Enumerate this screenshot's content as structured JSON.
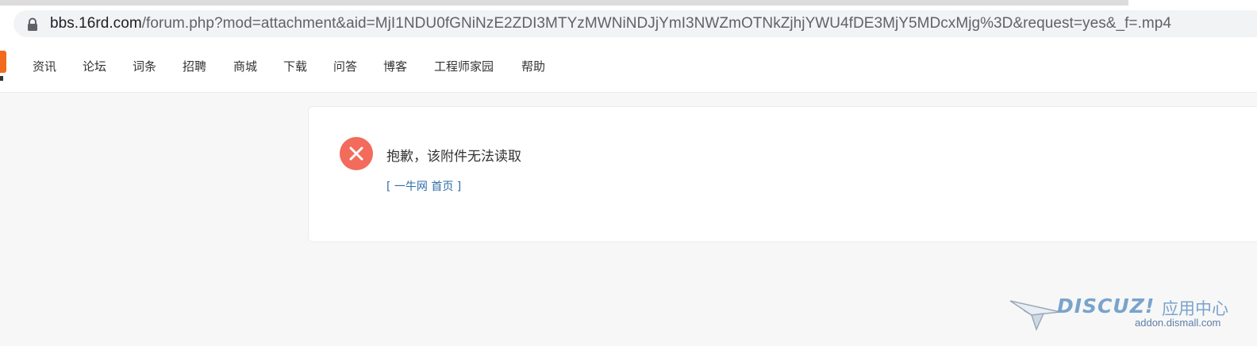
{
  "browser": {
    "url_host": "bbs.16rd.com",
    "url_rest": "/forum.php?mod=attachment&aid=MjI1NDU0fGNiNzE2ZDI3MTYzMWNiNDJjYmI3NWZmOTNkZjhjYWU4fDE3MjY5MDcxMjg%3D&request=yes&_f=.mp4"
  },
  "nav": {
    "items": [
      "资讯",
      "论坛",
      "词条",
      "招聘",
      "商城",
      "下载",
      "问答",
      "博客",
      "工程师家园",
      "帮助"
    ]
  },
  "message": {
    "text": "抱歉，该附件无法读取",
    "home_link": "[ 一牛网 首页 ]"
  },
  "watermark": {
    "brand": "DISCUZ!",
    "brand_zh": "应用中心",
    "domain": "addon.dismall.com"
  },
  "colors": {
    "error": "#f26b5b",
    "link": "#2f6ea6",
    "logo_accent": "#f26a1b"
  }
}
